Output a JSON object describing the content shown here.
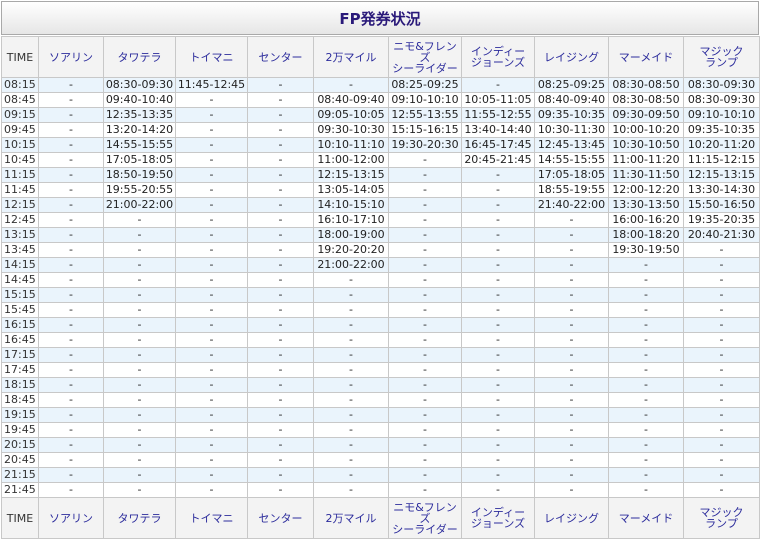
{
  "title": "FP発券状況",
  "columns": [
    "TIME",
    "ソアリン",
    "タワテラ",
    "トイマニ",
    "センター",
    "2万マイル",
    "ニモ&フレンズ\nシーライダー",
    "インディー\nジョーンズ",
    "レイジング",
    "マーメイド",
    "マジック\nランプ"
  ],
  "rows": [
    [
      "08:15",
      "-",
      "08:30-09:30",
      "11:45-12:45",
      "-",
      "-",
      "08:25-09:25",
      "-",
      "08:25-09:25",
      "08:30-08:50",
      "08:30-09:30"
    ],
    [
      "08:45",
      "-",
      "09:40-10:40",
      "-",
      "-",
      "08:40-09:40",
      "09:10-10:10",
      "10:05-11:05",
      "08:40-09:40",
      "08:30-08:50",
      "08:30-09:30"
    ],
    [
      "09:15",
      "-",
      "12:35-13:35",
      "-",
      "-",
      "09:05-10:05",
      "12:55-13:55",
      "11:55-12:55",
      "09:35-10:35",
      "09:30-09:50",
      "09:10-10:10"
    ],
    [
      "09:45",
      "-",
      "13:20-14:20",
      "-",
      "-",
      "09:30-10:30",
      "15:15-16:15",
      "13:40-14:40",
      "10:30-11:30",
      "10:00-10:20",
      "09:35-10:35"
    ],
    [
      "10:15",
      "-",
      "14:55-15:55",
      "-",
      "-",
      "10:10-11:10",
      "19:30-20:30",
      "16:45-17:45",
      "12:45-13:45",
      "10:30-10:50",
      "10:20-11:20"
    ],
    [
      "10:45",
      "-",
      "17:05-18:05",
      "-",
      "-",
      "11:00-12:00",
      "-",
      "20:45-21:45",
      "14:55-15:55",
      "11:00-11:20",
      "11:15-12:15"
    ],
    [
      "11:15",
      "-",
      "18:50-19:50",
      "-",
      "-",
      "12:15-13:15",
      "-",
      "-",
      "17:05-18:05",
      "11:30-11:50",
      "12:15-13:15"
    ],
    [
      "11:45",
      "-",
      "19:55-20:55",
      "-",
      "-",
      "13:05-14:05",
      "-",
      "-",
      "18:55-19:55",
      "12:00-12:20",
      "13:30-14:30"
    ],
    [
      "12:15",
      "-",
      "21:00-22:00",
      "-",
      "-",
      "14:10-15:10",
      "-",
      "-",
      "21:40-22:00",
      "13:30-13:50",
      "15:50-16:50"
    ],
    [
      "12:45",
      "-",
      "-",
      "-",
      "-",
      "16:10-17:10",
      "-",
      "-",
      "-",
      "16:00-16:20",
      "19:35-20:35"
    ],
    [
      "13:15",
      "-",
      "-",
      "-",
      "-",
      "18:00-19:00",
      "-",
      "-",
      "-",
      "18:00-18:20",
      "20:40-21:30"
    ],
    [
      "13:45",
      "-",
      "-",
      "-",
      "-",
      "19:20-20:20",
      "-",
      "-",
      "-",
      "19:30-19:50",
      "-"
    ],
    [
      "14:15",
      "-",
      "-",
      "-",
      "-",
      "21:00-22:00",
      "-",
      "-",
      "-",
      "-",
      "-"
    ],
    [
      "14:45",
      "-",
      "-",
      "-",
      "-",
      "-",
      "-",
      "-",
      "-",
      "-",
      "-"
    ],
    [
      "15:15",
      "-",
      "-",
      "-",
      "-",
      "-",
      "-",
      "-",
      "-",
      "-",
      "-"
    ],
    [
      "15:45",
      "-",
      "-",
      "-",
      "-",
      "-",
      "-",
      "-",
      "-",
      "-",
      "-"
    ],
    [
      "16:15",
      "-",
      "-",
      "-",
      "-",
      "-",
      "-",
      "-",
      "-",
      "-",
      "-"
    ],
    [
      "16:45",
      "-",
      "-",
      "-",
      "-",
      "-",
      "-",
      "-",
      "-",
      "-",
      "-"
    ],
    [
      "17:15",
      "-",
      "-",
      "-",
      "-",
      "-",
      "-",
      "-",
      "-",
      "-",
      "-"
    ],
    [
      "17:45",
      "-",
      "-",
      "-",
      "-",
      "-",
      "-",
      "-",
      "-",
      "-",
      "-"
    ],
    [
      "18:15",
      "-",
      "-",
      "-",
      "-",
      "-",
      "-",
      "-",
      "-",
      "-",
      "-"
    ],
    [
      "18:45",
      "-",
      "-",
      "-",
      "-",
      "-",
      "-",
      "-",
      "-",
      "-",
      "-"
    ],
    [
      "19:15",
      "-",
      "-",
      "-",
      "-",
      "-",
      "-",
      "-",
      "-",
      "-",
      "-"
    ],
    [
      "19:45",
      "-",
      "-",
      "-",
      "-",
      "-",
      "-",
      "-",
      "-",
      "-",
      "-"
    ],
    [
      "20:15",
      "-",
      "-",
      "-",
      "-",
      "-",
      "-",
      "-",
      "-",
      "-",
      "-"
    ],
    [
      "20:45",
      "-",
      "-",
      "-",
      "-",
      "-",
      "-",
      "-",
      "-",
      "-",
      "-"
    ],
    [
      "21:15",
      "-",
      "-",
      "-",
      "-",
      "-",
      "-",
      "-",
      "-",
      "-",
      "-"
    ],
    [
      "21:45",
      "-",
      "-",
      "-",
      "-",
      "-",
      "-",
      "-",
      "-",
      "-",
      "-"
    ]
  ],
  "colors": {
    "header_text": "#2c2c9c",
    "title_text": "#2a1a7a",
    "stripe": "#eaf4fc",
    "border": "#c8c8c8"
  }
}
